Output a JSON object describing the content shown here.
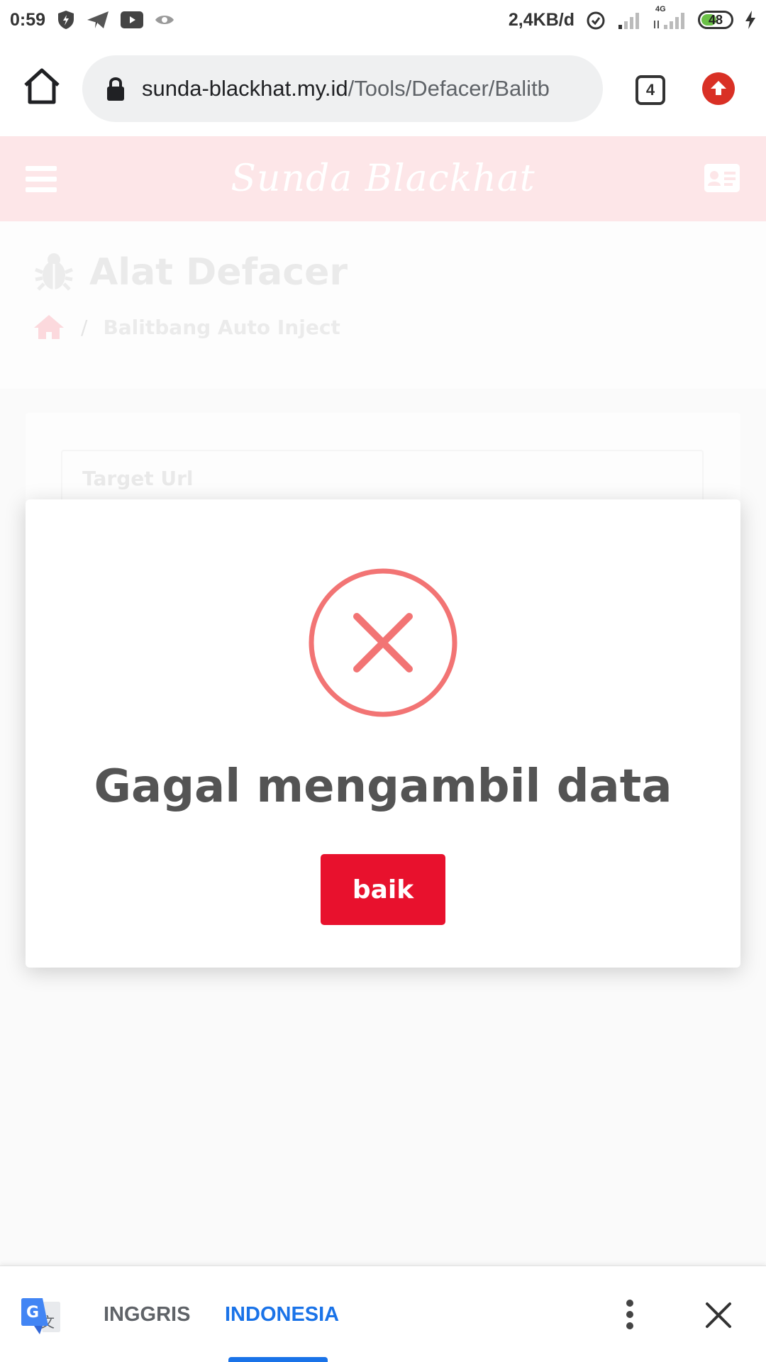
{
  "status_bar": {
    "time": "0:59",
    "network_speed": "2,4KB/d",
    "network_type": "4G",
    "battery": "48",
    "battery_level_percent": 48,
    "icons": [
      "shield-icon",
      "telegram-icon",
      "youtube-icon",
      "eye-icon",
      "alarm-icon",
      "signal-icon",
      "charging-icon"
    ]
  },
  "browser": {
    "url_host": "sunda-blackhat.my.id",
    "url_path": "/Tools/Defacer/Balitb",
    "tab_count": "4",
    "accent": "#d93025"
  },
  "site": {
    "brand": "Sunda Blackhat",
    "header_color": "#fde6e8"
  },
  "page": {
    "title": "Alat Defacer",
    "breadcrumb_current": "Balitbang Auto Inject",
    "breadcrumb_separator": "/",
    "target_placeholder": "Target Url"
  },
  "modal": {
    "title": "Gagal mengambil data",
    "button_label": "baik",
    "icon_color": "#f27474",
    "button_color": "#e8112d"
  },
  "translate_bar": {
    "source_language": "INGGRIS",
    "target_language": "INDONESIA",
    "active_color": "#1a73e8"
  }
}
